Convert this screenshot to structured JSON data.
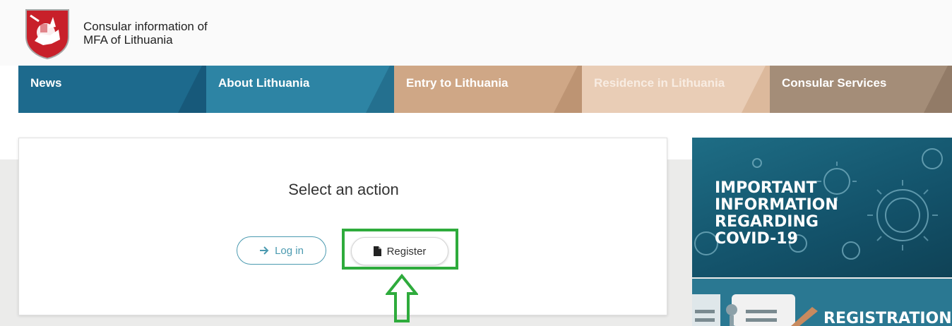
{
  "header": {
    "org_line1": "Consular information of",
    "org_line2": "MFA of Lithuania",
    "logo_icon": "coat-of-arms-vytis"
  },
  "nav": {
    "items": [
      {
        "label": "News",
        "color": "#1d6a8d"
      },
      {
        "label": "About Lithuania",
        "color": "#2d84a4"
      },
      {
        "label": "Entry to Lithuania",
        "color": "#cfa786"
      },
      {
        "label": "Residence in Lithuania",
        "color": "#e9cdb6"
      },
      {
        "label": "Consular Services",
        "color": "#a48d78"
      }
    ]
  },
  "action_card": {
    "title": "Select an action",
    "login_label": "Log in",
    "login_icon": "arrow-right-icon",
    "register_label": "Register",
    "register_icon": "document-icon"
  },
  "annotation": {
    "highlight_color": "#2eab3c",
    "arrow_icon": "up-arrow-icon"
  },
  "banners": {
    "covid_text": "IMPORTANT\nINFORMATION\nREGARDING\nCOVID-19",
    "registration_text": "REGISTRATION"
  }
}
